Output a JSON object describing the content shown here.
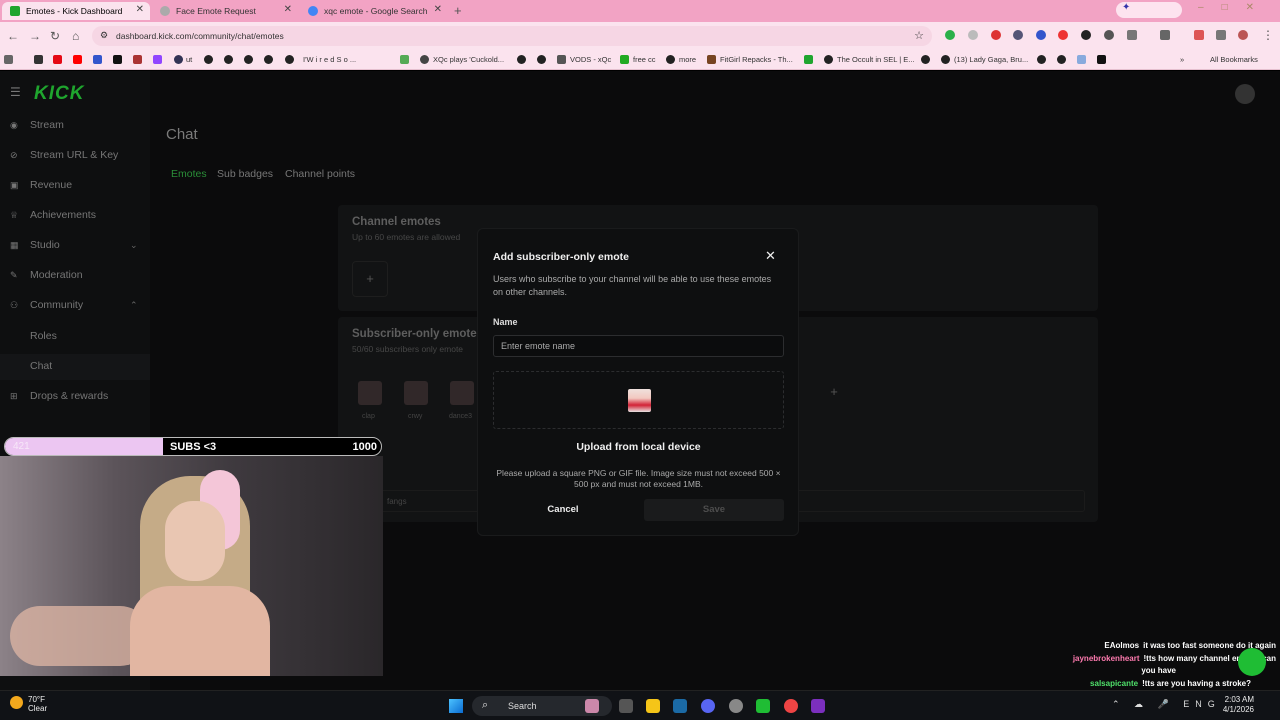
{
  "browser": {
    "tabs": [
      {
        "label": "Emotes - Kick Dashboard",
        "active": true
      },
      {
        "label": "Face Emote Request",
        "active": false
      },
      {
        "label": "xqc emote - Google Search",
        "active": false
      }
    ],
    "url": "dashboard.kick.com/community/chat/emotes",
    "bookmarks": [
      {
        "label": "ut"
      },
      {
        "label": "I'W i r e d   S o ..."
      },
      {
        "label": "XQc plays 'Cuckold..."
      },
      {
        "label": "VODS - xQc"
      },
      {
        "label": "free cc"
      },
      {
        "label": "more"
      },
      {
        "label": "FitGirl Repacks - Th..."
      },
      {
        "label": "The Occult in SEL | E..."
      },
      {
        "label": "(13) Lady Gaga, Bru..."
      }
    ],
    "all_bookmarks": "All Bookmarks"
  },
  "sidebar": {
    "logo": "KICK",
    "items": [
      {
        "label": "Stream"
      },
      {
        "label": "Stream URL & Key"
      },
      {
        "label": "Revenue"
      },
      {
        "label": "Achievements"
      },
      {
        "label": "Studio"
      },
      {
        "label": "Moderation"
      },
      {
        "label": "Community"
      },
      {
        "label": "Roles"
      },
      {
        "label": "Chat"
      },
      {
        "label": "Drops & rewards"
      }
    ]
  },
  "page": {
    "title": "Chat",
    "tabs": [
      "Emotes",
      "Sub badges",
      "Channel points"
    ],
    "channel_emotes": {
      "title": "Channel emotes",
      "subtitle": "Up to 60 emotes are allowed"
    },
    "subscriber_emotes": {
      "title": "Subscriber-only emote",
      "subtitle": "50/60 subscribers only emote",
      "emotes": [
        "clap",
        "crwy",
        "dance3"
      ]
    },
    "search_value": "fangs"
  },
  "modal": {
    "title": "Add subscriber-only emote",
    "description": "Users who subscribe to your channel will be able to use these emotes on other channels.",
    "name_label": "Name",
    "name_placeholder": "Enter emote name",
    "upload_label": "Upload from local device",
    "hint": "Please upload a square PNG or GIF file. Image size must not exceed 500 × 500 px and must not exceed 1MB.",
    "cancel": "Cancel",
    "save": "Save"
  },
  "overlay": {
    "subs_label": "SUBS <3",
    "subs_current": "421",
    "subs_target": "1000",
    "subs_progress": 0.421,
    "chat": [
      {
        "user": "EAolmos",
        "color": "#ffffff",
        "text": "it was too fast someone do it again"
      },
      {
        "user": "jaynebrokenheart",
        "color": "#ff7bb0",
        "text": "!tts how many channel emotes can"
      },
      {
        "user": "",
        "color": "#ffffff",
        "text": "you have"
      },
      {
        "user": "salsapicante",
        "color": "#4fe06a",
        "text": "!tts are you having a stroke?"
      }
    ]
  },
  "taskbar": {
    "weather_temp": "70°F",
    "weather_desc": "Clear",
    "search": "Search",
    "lang": "ENG",
    "time": "2:03 AM",
    "date": "4/1/2026"
  },
  "colors": {
    "kick_green": "#1fa52e",
    "accent_pink": "#f2a3c4"
  }
}
